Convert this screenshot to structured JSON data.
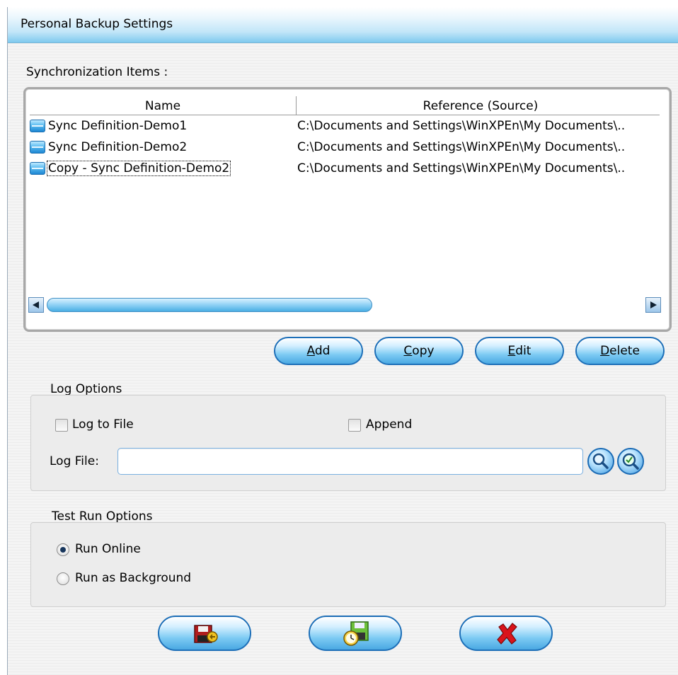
{
  "window": {
    "title": "Personal Backup Settings"
  },
  "sync": {
    "label": "Synchronization Items :",
    "columns": [
      "Name",
      "Reference (Source)"
    ],
    "rows": [
      {
        "name": "Sync Definition-Demo1",
        "source": "C:\\Documents and Settings\\WinXPEn\\My Documents\\.."
      },
      {
        "name": "Sync Definition-Demo2",
        "source": "C:\\Documents and Settings\\WinXPEn\\My Documents\\.."
      },
      {
        "name": "Copy - Sync Definition-Demo2",
        "source": "C:\\Documents and Settings\\WinXPEn\\My Documents\\.."
      }
    ],
    "icon": "sync-item-icon"
  },
  "buttons": {
    "add": {
      "accel": "A",
      "rest": "dd"
    },
    "copy": {
      "accel": "C",
      "rest": "opy"
    },
    "edit": {
      "accel": "E",
      "rest": "dit"
    },
    "delete": {
      "accel": "D",
      "rest": "elete"
    }
  },
  "log": {
    "title": "Log Options",
    "log_to_file": "Log to File",
    "append": "Append",
    "file_label": "Log File:",
    "file_value": "",
    "browse_icon": "magnifier-icon",
    "view_icon": "view-log-icon"
  },
  "test": {
    "title": "Test Run Options",
    "run_online": "Run Online",
    "run_background": "Run as Background",
    "selected": "run_online"
  },
  "footer": {
    "icons": [
      "save-icon",
      "schedule-icon",
      "close-icon"
    ]
  },
  "colors": {
    "accent": "#4aa8e2",
    "border": "#1d6fb8",
    "close": "#d9141c"
  }
}
